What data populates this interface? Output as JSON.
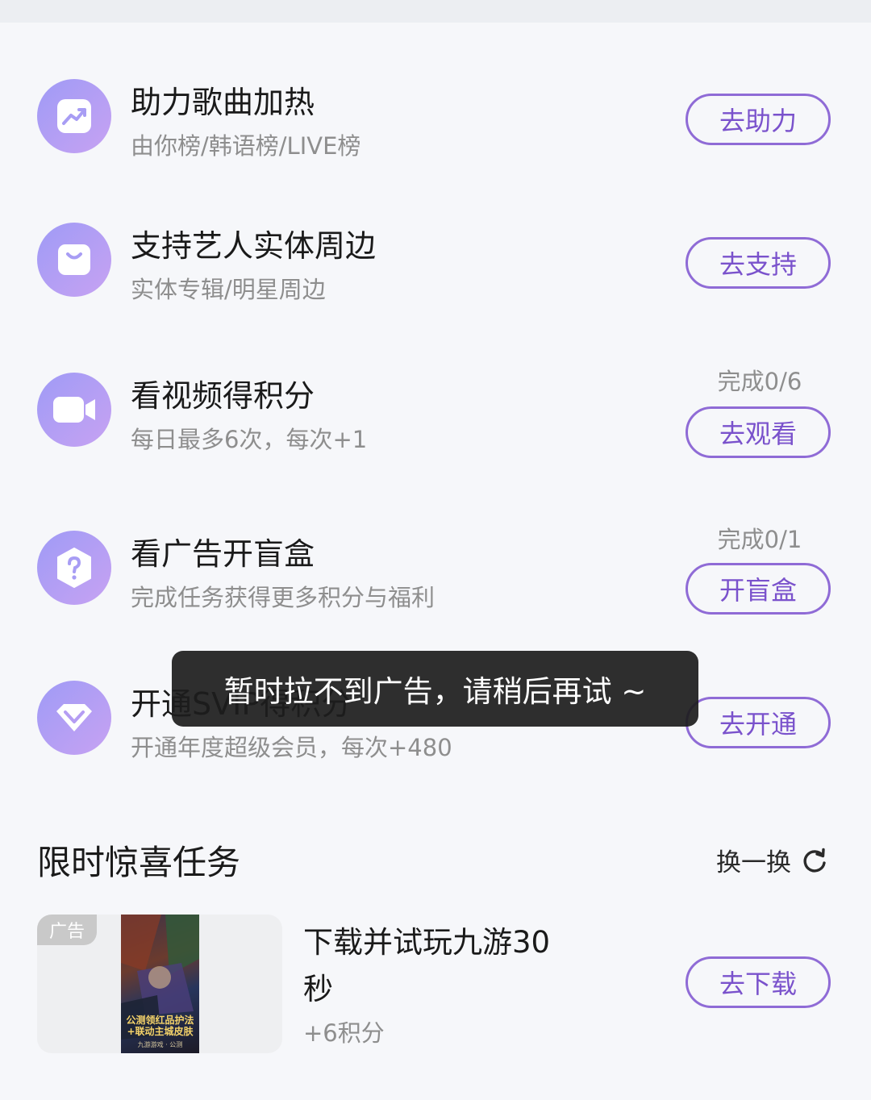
{
  "tasks": [
    {
      "icon": "trending-up-icon",
      "title": "助力歌曲加热",
      "subtitle": "由你榜/韩语榜/LIVE榜",
      "progress": "",
      "button": "去助力"
    },
    {
      "icon": "shopping-bag-icon",
      "title": "支持艺人实体周边",
      "subtitle": "实体专辑/明星周边",
      "progress": "",
      "button": "去支持"
    },
    {
      "icon": "video-camera-icon",
      "title": "看视频得积分",
      "subtitle": "每日最多6次，每次+1",
      "progress": "完成0/6",
      "button": "去观看"
    },
    {
      "icon": "question-box-icon",
      "title": "看广告开盲盒",
      "subtitle": "完成任务获得更多积分与福利",
      "progress": "完成0/1",
      "button": "开盲盒"
    },
    {
      "icon": "diamond-icon",
      "title": "开通SVIP得积分",
      "subtitle": "开通年度超级会员，每次+480",
      "progress": "",
      "button": "去开通"
    }
  ],
  "surprise": {
    "title": "限时惊喜任务",
    "refresh_label": "换一换",
    "refresh_icon": "refresh-icon",
    "ad_badge": "广告",
    "poster_text": "公测领红品护法+联动主城皮肤",
    "poster_subtext": "九游游戏 · 公测",
    "ad_title": "下载并试玩九游30秒",
    "ad_points": "+6积分",
    "ad_button": "去下载"
  },
  "toast": "暂时拉不到广告，请稍后再试 ~",
  "colors": {
    "accent": "#8f6bd6",
    "icon_gradient_start": "#9f9bf6",
    "icon_gradient_end": "#c7a2f2",
    "toast_bg": "#1c1c1c"
  }
}
